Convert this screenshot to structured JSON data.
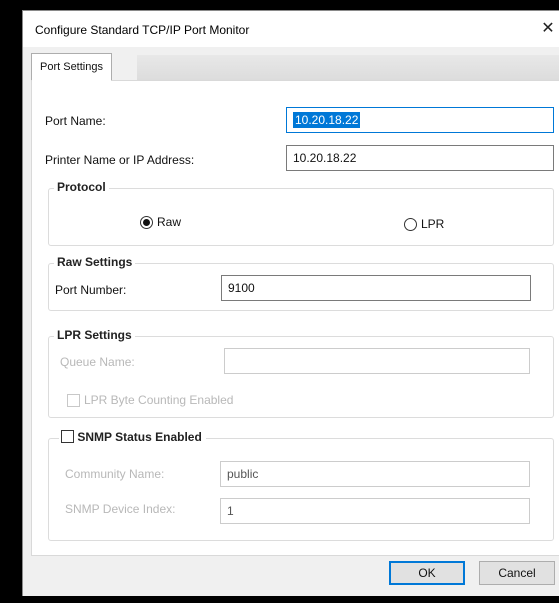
{
  "window": {
    "title": "Configure Standard TCP/IP Port Monitor",
    "close_glyph": "✕"
  },
  "tabs": [
    {
      "label": "Port Settings",
      "selected": true
    }
  ],
  "port": {
    "name_label": "Port Name:",
    "name_value": "10.20.18.22",
    "address_label": "Printer Name or IP Address:",
    "address_value": "10.20.18.22"
  },
  "protocol": {
    "title": "Protocol",
    "options": [
      {
        "label": "Raw",
        "checked": true
      },
      {
        "label": "LPR",
        "checked": false
      }
    ]
  },
  "raw_settings": {
    "title": "Raw Settings",
    "port_number_label": "Port Number:",
    "port_number_value": "9100"
  },
  "lpr_settings": {
    "title": "LPR Settings",
    "queue_name_label": "Queue Name:",
    "queue_name_value": "",
    "byte_counting_label": "LPR Byte Counting Enabled",
    "byte_counting_checked": false
  },
  "snmp": {
    "enabled_label": "SNMP Status Enabled",
    "enabled_checked": false,
    "community_label": "Community Name:",
    "community_value": "public",
    "device_index_label": "SNMP Device Index:",
    "device_index_value": "1"
  },
  "buttons": {
    "ok": "OK",
    "cancel": "Cancel"
  },
  "colors": {
    "accent": "#0078d7",
    "dialog_bg": "#f0f0f0",
    "panel_bg": "#ffffff"
  }
}
